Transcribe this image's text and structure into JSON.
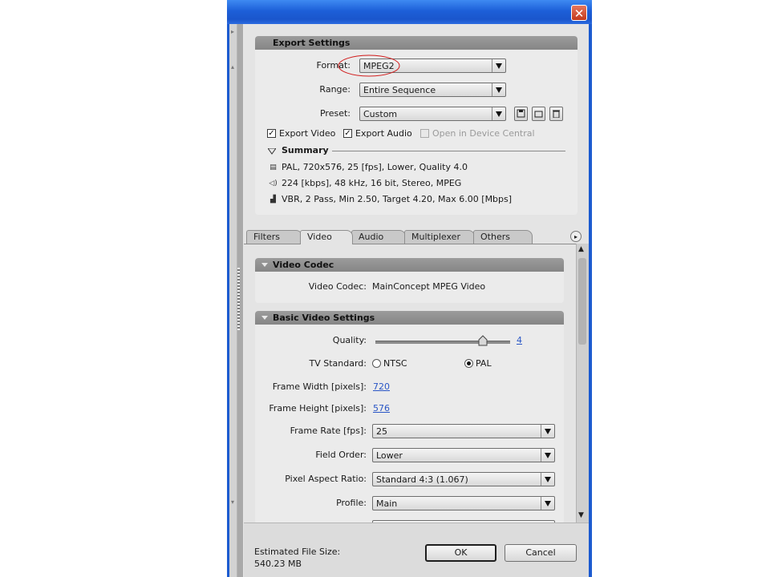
{
  "dialog": {
    "title": "",
    "close_glyph": "✕",
    "left_strip_arrows": [
      "▸",
      "▴",
      "▾"
    ]
  },
  "export_settings": {
    "header": "Export Settings",
    "format": {
      "label": "Format:",
      "value": "MPEG2"
    },
    "range": {
      "label": "Range:",
      "value": "Entire Sequence"
    },
    "preset": {
      "label": "Preset:",
      "value": "Custom",
      "buttons": [
        "save-preset-icon",
        "import-preset-icon",
        "delete-preset-icon"
      ]
    },
    "export_video": {
      "label": "Export Video",
      "checked": true
    },
    "export_audio": {
      "label": "Export Audio",
      "checked": true
    },
    "open_device_central": {
      "label": "Open in Device Central",
      "checked": false,
      "enabled": false
    },
    "summary": {
      "title": "Summary",
      "lines": [
        {
          "icon": "film-icon",
          "text": "PAL, 720x576, 25 [fps], Lower, Quality 4.0"
        },
        {
          "icon": "speaker-icon",
          "text": "224 [kbps], 48 kHz, 16 bit, Stereo, MPEG"
        },
        {
          "icon": "chart-icon",
          "text": "VBR, 2 Pass, Min 2.50, Target 4.20, Max 6.00 [Mbps]"
        }
      ]
    }
  },
  "tabs": {
    "items": [
      "Filters",
      "Video",
      "Audio",
      "Multiplexer",
      "Others"
    ],
    "active": "Video",
    "menu_glyph": "▸"
  },
  "video_codec": {
    "header": "Video Codec",
    "label": "Video Codec:",
    "value": "MainConcept MPEG Video"
  },
  "basic_video": {
    "header": "Basic Video Settings",
    "quality": {
      "label": "Quality:",
      "value": "4",
      "fraction": 0.8
    },
    "tv_standard": {
      "label": "TV Standard:",
      "options": [
        "NTSC",
        "PAL"
      ],
      "selected": "PAL"
    },
    "frame_width": {
      "label": "Frame Width [pixels]:",
      "value": "720"
    },
    "frame_height": {
      "label": "Frame Height [pixels]:",
      "value": "576"
    },
    "frame_rate": {
      "label": "Frame Rate [fps]:",
      "value": "25"
    },
    "field_order": {
      "label": "Field Order:",
      "value": "Lower"
    },
    "pixel_aspect": {
      "label": "Pixel Aspect Ratio:",
      "value": "Standard 4:3 (1.067)"
    },
    "profile": {
      "label": "Profile:",
      "value": "Main"
    }
  },
  "scrollbar": {
    "up": "▲",
    "down": "▼"
  },
  "footer": {
    "estimated_label": "Estimated File Size:",
    "estimated_value": "540.23 MB",
    "ok": "OK",
    "cancel": "Cancel"
  },
  "colors": {
    "titlebar": "#1d5fd8",
    "annotation_ellipse": "#d11b1b",
    "link": "#2a56c6",
    "panel_header": "#8f8f8f"
  }
}
